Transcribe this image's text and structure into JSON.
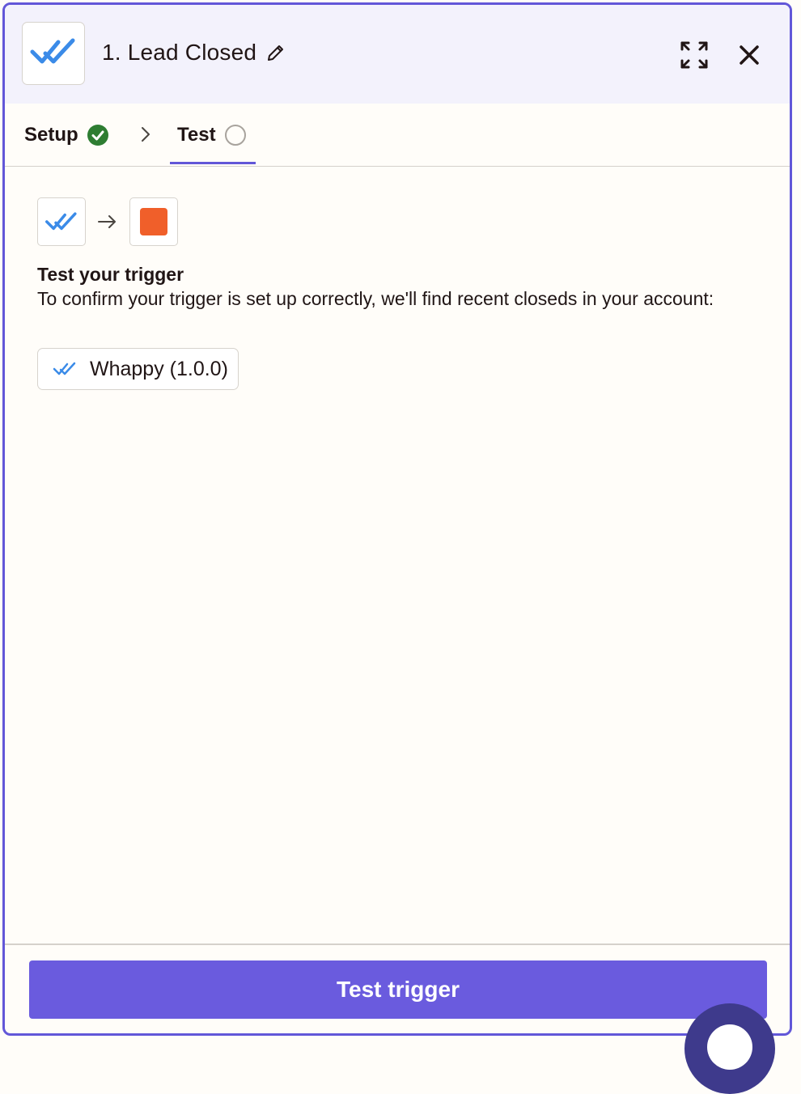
{
  "header": {
    "title": "1. Lead Closed",
    "app_icon": "whappy-double-check-icon",
    "edit_icon": "pencil-icon",
    "expand_icon": "expand-icon",
    "close_icon": "close-icon"
  },
  "tabs": [
    {
      "label": "Setup",
      "status": "complete",
      "status_icon": "check-circle-icon"
    },
    {
      "label": "Test",
      "status": "incomplete",
      "status_icon": "empty-circle-icon",
      "active": true
    }
  ],
  "tab_separator_icon": "chevron-right-icon",
  "flow": {
    "source_icon": "whappy-double-check-icon",
    "arrow_icon": "arrow-right-icon",
    "target_color": "#f05f2a"
  },
  "test": {
    "heading": "Test your trigger",
    "description": "To confirm your trigger is set up correctly, we'll find recent closeds in your account:",
    "account_chip": "Whappy (1.0.0)"
  },
  "footer": {
    "button_label": "Test trigger"
  },
  "colors": {
    "accent": "#6a5bde",
    "border": "#6257d8",
    "success": "#2e7d32",
    "brand_blue": "#3b8be8"
  }
}
